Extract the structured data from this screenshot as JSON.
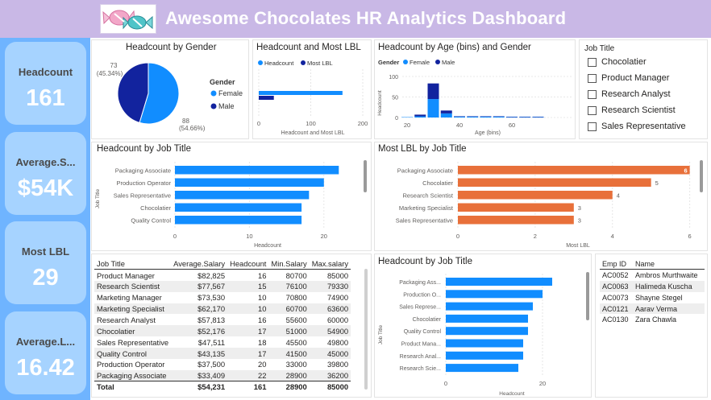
{
  "header": {
    "title": "Awesome Chocolates HR Analytics Dashboard",
    "logo_icon": "candy-icon"
  },
  "kpis": [
    {
      "label": "Headcount",
      "value": "161"
    },
    {
      "label": "Average.S...",
      "value": "$54K"
    },
    {
      "label": "Most LBL",
      "value": "29"
    },
    {
      "label": "Average.L...",
      "value": "16.42"
    }
  ],
  "colors": {
    "female": "#118dff",
    "male": "#12239e",
    "orange": "#e8703a",
    "kpi_bg": "#6fb4ff",
    "kpi_card": "#a6d3ff",
    "header": "#c9b8e6"
  },
  "gender_chart": {
    "title": "Headcount by Gender",
    "legend_title": "Gender",
    "chart_data": {
      "type": "pie",
      "slices": [
        {
          "name": "Female",
          "value": 88,
          "label": "88",
          "pct": "(54.66%)"
        },
        {
          "name": "Male",
          "value": 73,
          "label": "73",
          "pct": "(45.34%)"
        }
      ]
    }
  },
  "lbl_chart": {
    "title": "Headcount and Most LBL",
    "chart_data": {
      "type": "bar",
      "series": [
        {
          "name": "Headcount",
          "values": [
            161
          ]
        },
        {
          "name": "Most LBL",
          "values": [
            29
          ]
        }
      ],
      "xlabel": "Headcount and Most LBL",
      "xticks": [
        "0",
        "100",
        "200"
      ],
      "xlim": [
        0,
        200
      ]
    }
  },
  "age_chart": {
    "title": "Headcount by Age (bins) and Gender",
    "legend_title": "Gender",
    "chart_data": {
      "type": "bar",
      "x": [
        20,
        25,
        30,
        35,
        40,
        45,
        50,
        55,
        60,
        65,
        70
      ],
      "series": [
        {
          "name": "Female",
          "values": [
            1,
            3,
            45,
            10,
            2,
            2,
            2,
            2,
            1,
            1,
            1
          ]
        },
        {
          "name": "Male",
          "values": [
            0,
            4,
            38,
            7,
            1,
            1,
            1,
            1,
            1,
            1,
            1
          ]
        }
      ],
      "ylabel": "Headcount",
      "xlabel": "Age (bins)",
      "yticks": [
        "0",
        "50",
        "100"
      ],
      "xticks": [
        "20",
        "40",
        "60"
      ],
      "ylim": [
        0,
        100
      ]
    }
  },
  "slicer": {
    "title": "Job Title",
    "items": [
      "Chocolatier",
      "Product Manager",
      "Research Analyst",
      "Research Scientist",
      "Sales Representative"
    ]
  },
  "job_chart": {
    "title": "Headcount by Job Title",
    "chart_data": {
      "type": "bar",
      "categories": [
        "Packaging Associate",
        "Production Operator",
        "Sales Representative",
        "Chocolatier",
        "Quality Control"
      ],
      "values": [
        22,
        20,
        18,
        17,
        17
      ],
      "ylabel": "Job Title",
      "xlabel": "Headcount",
      "xticks": [
        "0",
        "10",
        "20"
      ],
      "xlim": [
        0,
        25
      ]
    }
  },
  "lbl_job_chart": {
    "title": "Most LBL by Job Title",
    "chart_data": {
      "type": "bar",
      "categories": [
        "Packaging Associate",
        "Chocolatier",
        "Research Scientist",
        "Marketing Specialist",
        "Sales Representative"
      ],
      "values": [
        6,
        5,
        4,
        3,
        3
      ],
      "xlabel": "Most LBL",
      "xticks": [
        "0",
        "2",
        "4",
        "6"
      ],
      "xlim": [
        0,
        6.3
      ]
    }
  },
  "table": {
    "headers": [
      "Job Title",
      "Average.Salary",
      "Headcount",
      "Min.Salary",
      "Max.salary"
    ],
    "rows": [
      [
        "Product Manager",
        "$82,825",
        "16",
        "80700",
        "85000"
      ],
      [
        "Research Scientist",
        "$77,567",
        "15",
        "76100",
        "79330"
      ],
      [
        "Marketing Manager",
        "$73,530",
        "10",
        "70800",
        "74900"
      ],
      [
        "Marketing Specialist",
        "$62,170",
        "10",
        "60700",
        "63600"
      ],
      [
        "Research Analyst",
        "$57,813",
        "16",
        "55600",
        "60000"
      ],
      [
        "Chocolatier",
        "$52,176",
        "17",
        "51000",
        "54900"
      ],
      [
        "Sales Representative",
        "$47,511",
        "18",
        "45500",
        "49800"
      ],
      [
        "Quality Control",
        "$43,135",
        "17",
        "41500",
        "45000"
      ],
      [
        "Production Operator",
        "$37,500",
        "20",
        "33000",
        "39800"
      ],
      [
        "Packaging Associate",
        "$33,409",
        "22",
        "28900",
        "36200"
      ]
    ],
    "total": [
      "Total",
      "$54,231",
      "161",
      "28900",
      "85000"
    ]
  },
  "job_chart2": {
    "title": "Headcount by Job Title",
    "chart_data": {
      "type": "bar",
      "categories": [
        "Packaging Ass...",
        "Production O...",
        "Sales Represe...",
        "Chocolatier",
        "Quality Control",
        "Product Mana...",
        "Research Anal...",
        "Research Scie..."
      ],
      "values": [
        22,
        20,
        18,
        17,
        17,
        16,
        16,
        15
      ],
      "ylabel": "Job Title",
      "xlabel": "Headcount",
      "xticks": [
        "0",
        "20"
      ],
      "xlim": [
        0,
        28
      ]
    }
  },
  "emp_table": {
    "headers": [
      "Emp ID",
      "Name"
    ],
    "rows": [
      [
        "AC0052",
        "Ambros Murthwaite"
      ],
      [
        "AC0063",
        "Halimeda Kuscha"
      ],
      [
        "AC0073",
        "Shayne Stegel"
      ],
      [
        "AC0121",
        "Aarav Verma"
      ],
      [
        "AC0130",
        "Zara Chawla"
      ]
    ]
  }
}
